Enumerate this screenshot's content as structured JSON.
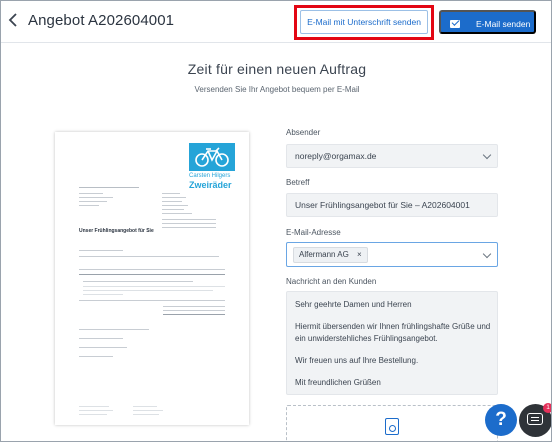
{
  "header": {
    "back_icon": "chevron-left-icon",
    "title": "Angebot A202604001",
    "email_signature_label": "E-Mail mit Unterschrift senden",
    "email_send_label": "E-Mail senden",
    "email_send_icon": "envelope-icon",
    "highlight_color": "#e30613"
  },
  "hero": {
    "title": "Zeit für einen neuen Auftrag",
    "subtitle": "Versenden Sie Ihr Angebot bequem per E-Mail"
  },
  "preview": {
    "logo_name": "Carsten Hilgers",
    "logo_brand": "Zweiräder",
    "doc_title": "Unser Frühlingsangebot für Sie",
    "logo_color": "#25a4d8"
  },
  "form": {
    "sender_label": "Absender",
    "sender_value": "noreply@orgamax.de",
    "subject_label": "Betreff",
    "subject_value": "Unser Frühlingsangebot für Sie – A202604001",
    "recipient_label": "E-Mail-Adresse",
    "recipient_tag": "Alfermann AG",
    "recipient_tag_remove": "×",
    "message_label": "Nachricht an den Kunden",
    "message_lines": [
      "Sehr geehrte Damen und Herren",
      "Hiermit übersenden wir Ihnen frühlingshafte Grüße und",
      "ein unwiderstehliches Frühlingsangebot.",
      "Wir freuen uns auf Ihre Bestellung.",
      "Mit freundlichen Grüßen"
    ]
  },
  "floating": {
    "help_label": "?",
    "chat_badge": "1"
  },
  "colors": {
    "primary": "#1c6ccb"
  }
}
